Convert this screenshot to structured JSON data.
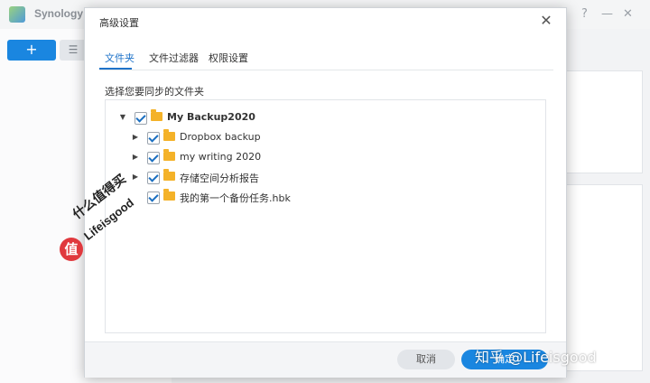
{
  "app": {
    "title": "Synology",
    "add_label": "+",
    "list_label": "☰",
    "help_label": "?",
    "minimize_label": "—",
    "close_label": "✕"
  },
  "dialog": {
    "title": "高级设置",
    "close_label": "✕",
    "tabs": [
      {
        "label": "文件夹",
        "active": true
      },
      {
        "label": "文件过滤器",
        "active": false
      },
      {
        "label": "权限设置",
        "active": false
      }
    ],
    "section_label": "选择您要同步的文件夹",
    "tree": [
      {
        "label": "My Backup2020",
        "level": 0,
        "expanded": true,
        "has_children": true,
        "checked": true,
        "bold": true
      },
      {
        "label": "Dropbox backup",
        "level": 1,
        "expanded": false,
        "has_children": true,
        "checked": true,
        "bold": false
      },
      {
        "label": "my writing 2020",
        "level": 1,
        "expanded": false,
        "has_children": true,
        "checked": true,
        "bold": false
      },
      {
        "label": "存储空间分析报告",
        "level": 1,
        "expanded": false,
        "has_children": true,
        "checked": true,
        "bold": false
      },
      {
        "label": "我的第一个备份任务.hbk",
        "level": 1,
        "expanded": false,
        "has_children": false,
        "checked": true,
        "bold": false
      }
    ],
    "cancel_label": "取消",
    "ok_label": "确定"
  },
  "watermarks": {
    "badge": "值",
    "stamp_line1": "什么值得买",
    "stamp_line2": "Lifeisgood",
    "zhihu": "知乎 @Lifeisgood"
  },
  "colors": {
    "accent": "#1a86e0",
    "folder": "#f4b228",
    "badge": "#e0393e"
  }
}
